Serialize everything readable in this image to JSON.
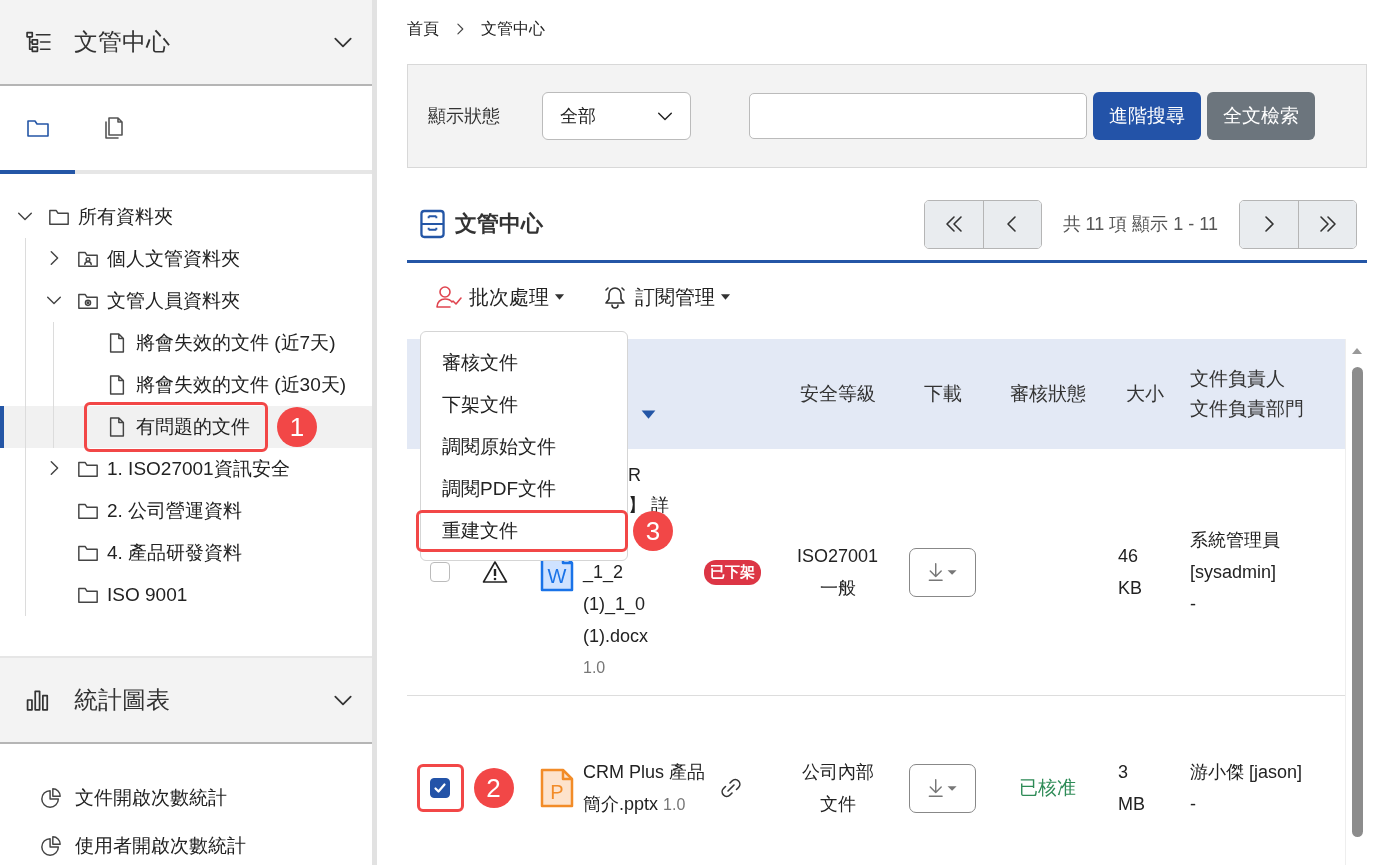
{
  "sidebar": {
    "header": {
      "title": "文管中心"
    },
    "tabs": [
      {
        "kind": "folder",
        "selected": true
      },
      {
        "kind": "documents",
        "selected": false
      }
    ],
    "tree": [
      {
        "label": "所有資料夾",
        "kind": "folder",
        "expanded": true,
        "selected": false,
        "children": [
          {
            "label": "個人文管資料夾",
            "kind": "person-folder",
            "expanded": false,
            "selected": false
          },
          {
            "label": "文管人員資料夾",
            "kind": "gear-folder",
            "expanded": true,
            "selected": false,
            "children": [
              {
                "label": "將會失效的文件 (近7天)",
                "kind": "file",
                "selected": false
              },
              {
                "label": "將會失效的文件 (近30天)",
                "kind": "file",
                "selected": false
              },
              {
                "label": "有問題的文件",
                "kind": "file",
                "selected": true,
                "callout": "1"
              }
            ]
          },
          {
            "label": "1. ISO27001資訊安全",
            "kind": "folder",
            "expanded": false,
            "selected": false
          },
          {
            "label": "2. 公司營運資料",
            "kind": "folder",
            "selected": false
          },
          {
            "label": "4. 產品研發資料",
            "kind": "folder",
            "selected": false
          },
          {
            "label": "ISO 9001",
            "kind": "folder",
            "selected": false
          }
        ]
      }
    ],
    "stats_panel": {
      "title": "統計圖表",
      "items": [
        "文件開啟次數統計",
        "使用者開啟次數統計"
      ]
    }
  },
  "breadcrumb": [
    "首頁",
    "文管中心"
  ],
  "filter": {
    "label": "顯示狀態",
    "status_select": "全部",
    "buttons": [
      {
        "label": "進階搜尋",
        "kind": "primary"
      },
      {
        "label": "全文檢索",
        "kind": "secondary"
      }
    ]
  },
  "section": {
    "title": "文管中心",
    "pager_summary": "共 11 項 顯示 1 - 11"
  },
  "toolbar": [
    {
      "label": "批次處理",
      "kind": "batch"
    },
    {
      "label": "訂閱管理",
      "kind": "subscription"
    }
  ],
  "batch_menu": [
    {
      "label": "審核文件"
    },
    {
      "label": "下架文件"
    },
    {
      "label": "調閱原始文件"
    },
    {
      "label": "調閱PDF文件"
    },
    {
      "label": "重建文件",
      "callout": "3"
    }
  ],
  "table": {
    "columns": [
      {
        "kind": "select"
      },
      {
        "kind": "status"
      },
      {
        "kind": "name",
        "sorted": true
      },
      {
        "kind": "tag"
      },
      {
        "kind": "label",
        "lines": [
          "安全等級"
        ]
      },
      {
        "kind": "label",
        "lines": [
          "下載"
        ]
      },
      {
        "kind": "label",
        "lines": [
          "審核狀態"
        ]
      },
      {
        "kind": "label",
        "lines": [
          "大小"
        ]
      },
      {
        "kind": "owner",
        "lines": [
          "文件負責人",
          "文件負責部門"
        ]
      }
    ],
    "rows": [
      {
        "checked": false,
        "warning": true,
        "kind": "word",
        "file_letter": "W",
        "name_lines": [
          {
            "text": "R",
            "clipped": true
          },
          {
            "text": "】 詳",
            "clipped": true
          },
          {
            "text": "_1_2",
            "clipped": false
          },
          {
            "text": "(1)_1_0",
            "clipped": false
          },
          {
            "text": "(1).docx",
            "clipped": false
          },
          {
            "version": "1.0",
            "clipped": false
          }
        ],
        "linked": false,
        "badge": "已下架",
        "security_lines": [
          "ISO27001",
          "一般"
        ],
        "size_lines": [
          "46",
          "KB"
        ],
        "owner_lines": [
          "系統管理員",
          "[sysadmin]",
          "-"
        ]
      },
      {
        "checked": true,
        "callout": "2",
        "kind": "powerpoint",
        "file_letter": "P",
        "name_lines": [
          {
            "text": "CRM Plus 產品",
            "clipped": false
          },
          {
            "text": "簡介.pptx",
            "version": "1.0",
            "clipped": false
          }
        ],
        "linked": true,
        "security_lines": [
          "公司內部",
          "文件"
        ],
        "review_status": "已核准",
        "size_lines": [
          "3",
          "MB"
        ],
        "owner_lines": [
          "游小傑 [jason]",
          "-"
        ]
      }
    ]
  }
}
